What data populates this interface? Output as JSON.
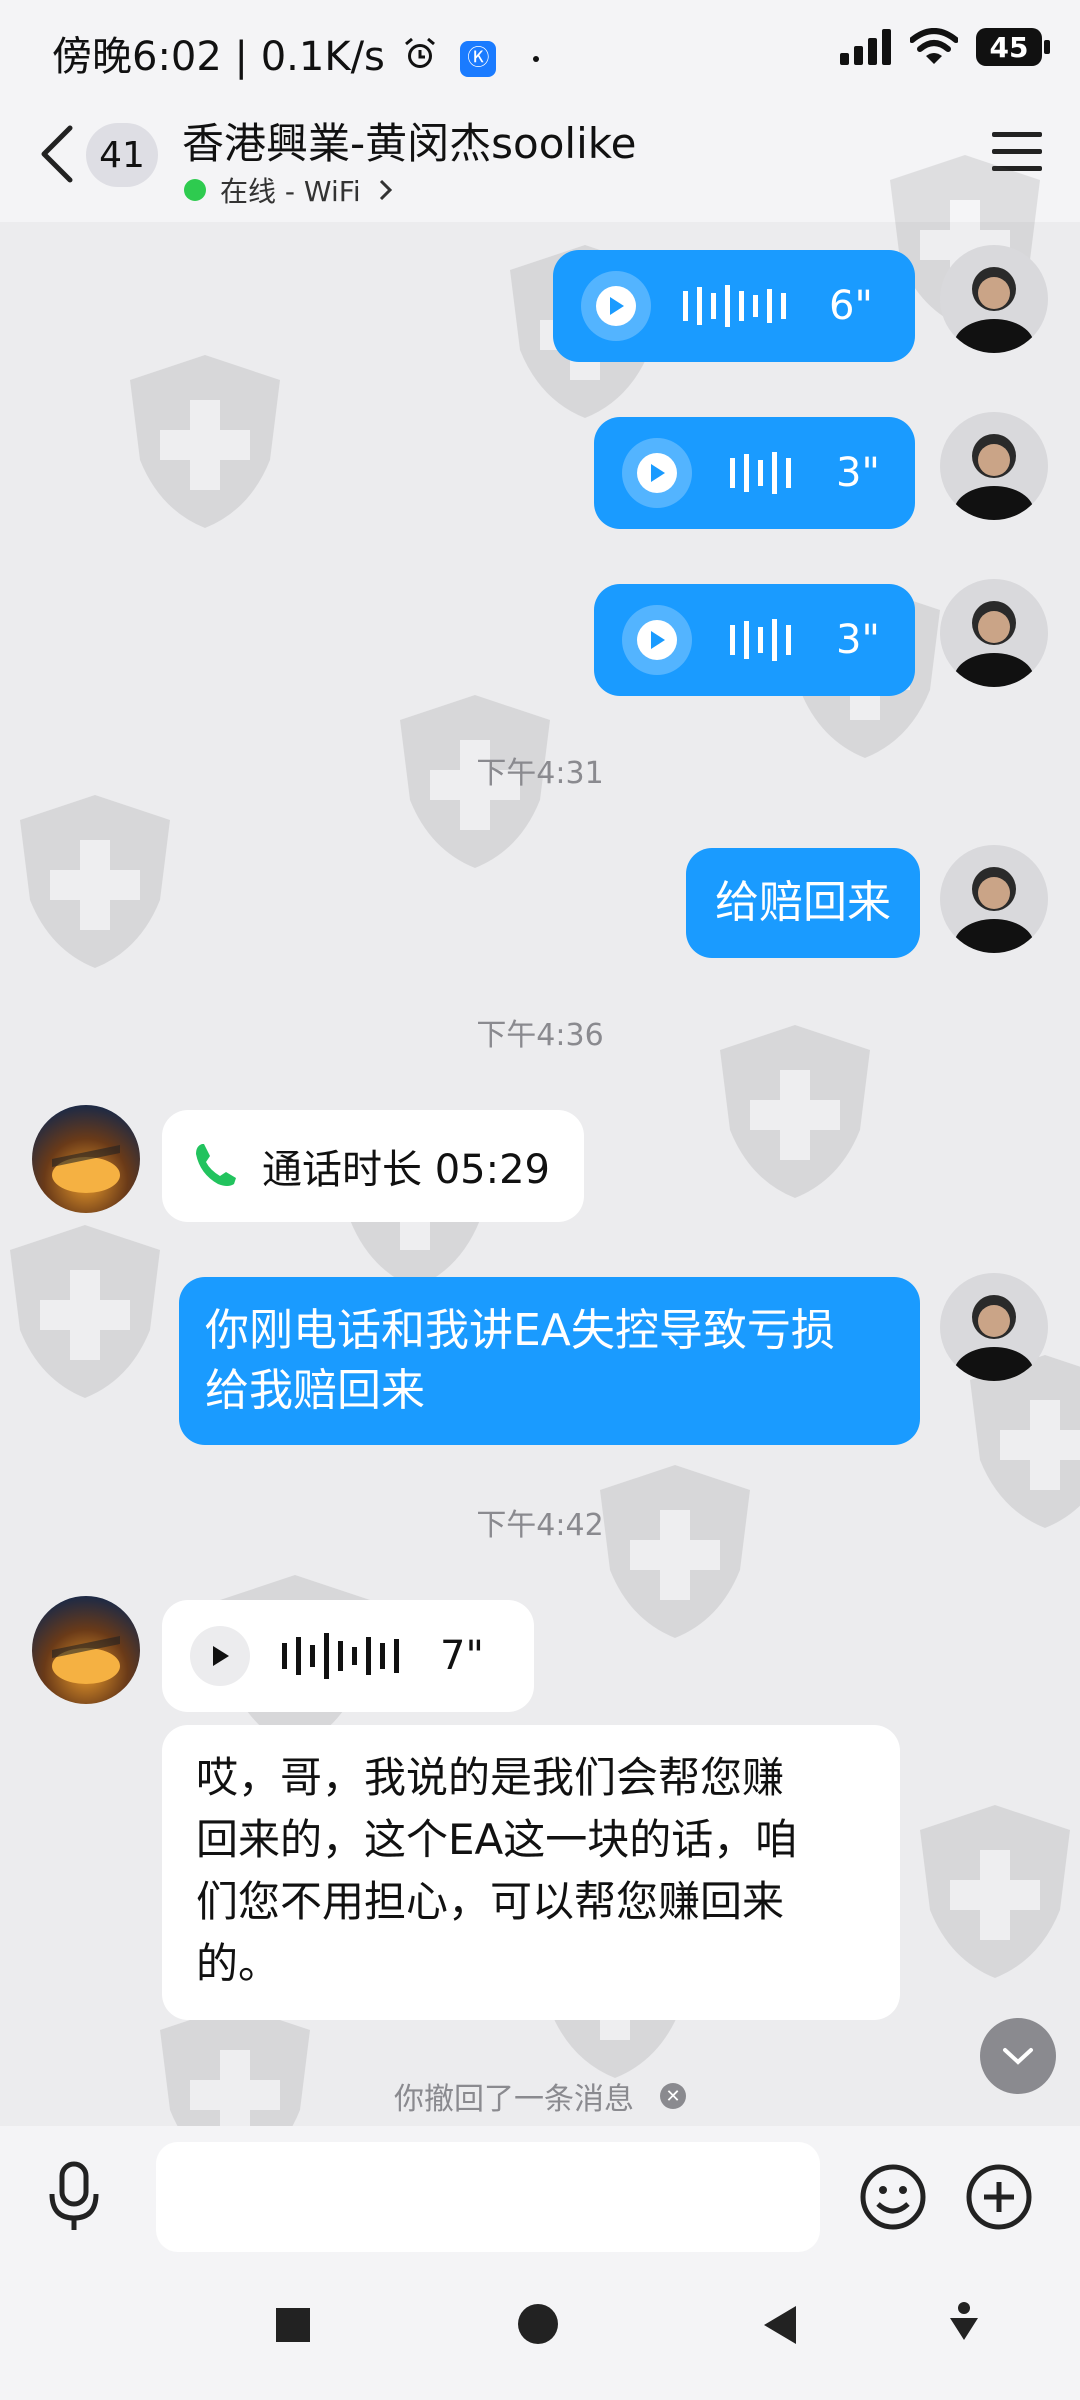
{
  "status_bar": {
    "time": "傍晚6:02 | 0.1K/s",
    "battery": "45"
  },
  "header": {
    "unread_count": "41",
    "title": "香港興業-黄闵杰soolike",
    "status": "在线 - WiFi"
  },
  "messages": {
    "voice1_duration": "6\"",
    "voice2_duration": "3\"",
    "voice3_duration": "3\"",
    "time1": "下午4:31",
    "text1": "给赔回来",
    "time2": "下午4:36",
    "call_label": "通话时长 05:29",
    "text2_line1": "你刚电话和我讲EA失控导致亏损",
    "text2_line2": "给我赔回来",
    "time3": "下午4:42",
    "voice4_duration": "7\"",
    "transcript_line1": "哎，哥，我说的是我们会帮您赚",
    "transcript_line2": "回来的，这个EA这一块的话，咱",
    "transcript_line3": "们您不用担心，可以帮您赚回来",
    "transcript_line4": "的。",
    "recall_notice": "你撤回了一条消息"
  },
  "colors": {
    "accent_blue": "#1a9bff",
    "online_green": "#2ecb4f",
    "call_green": "#22c35e"
  }
}
